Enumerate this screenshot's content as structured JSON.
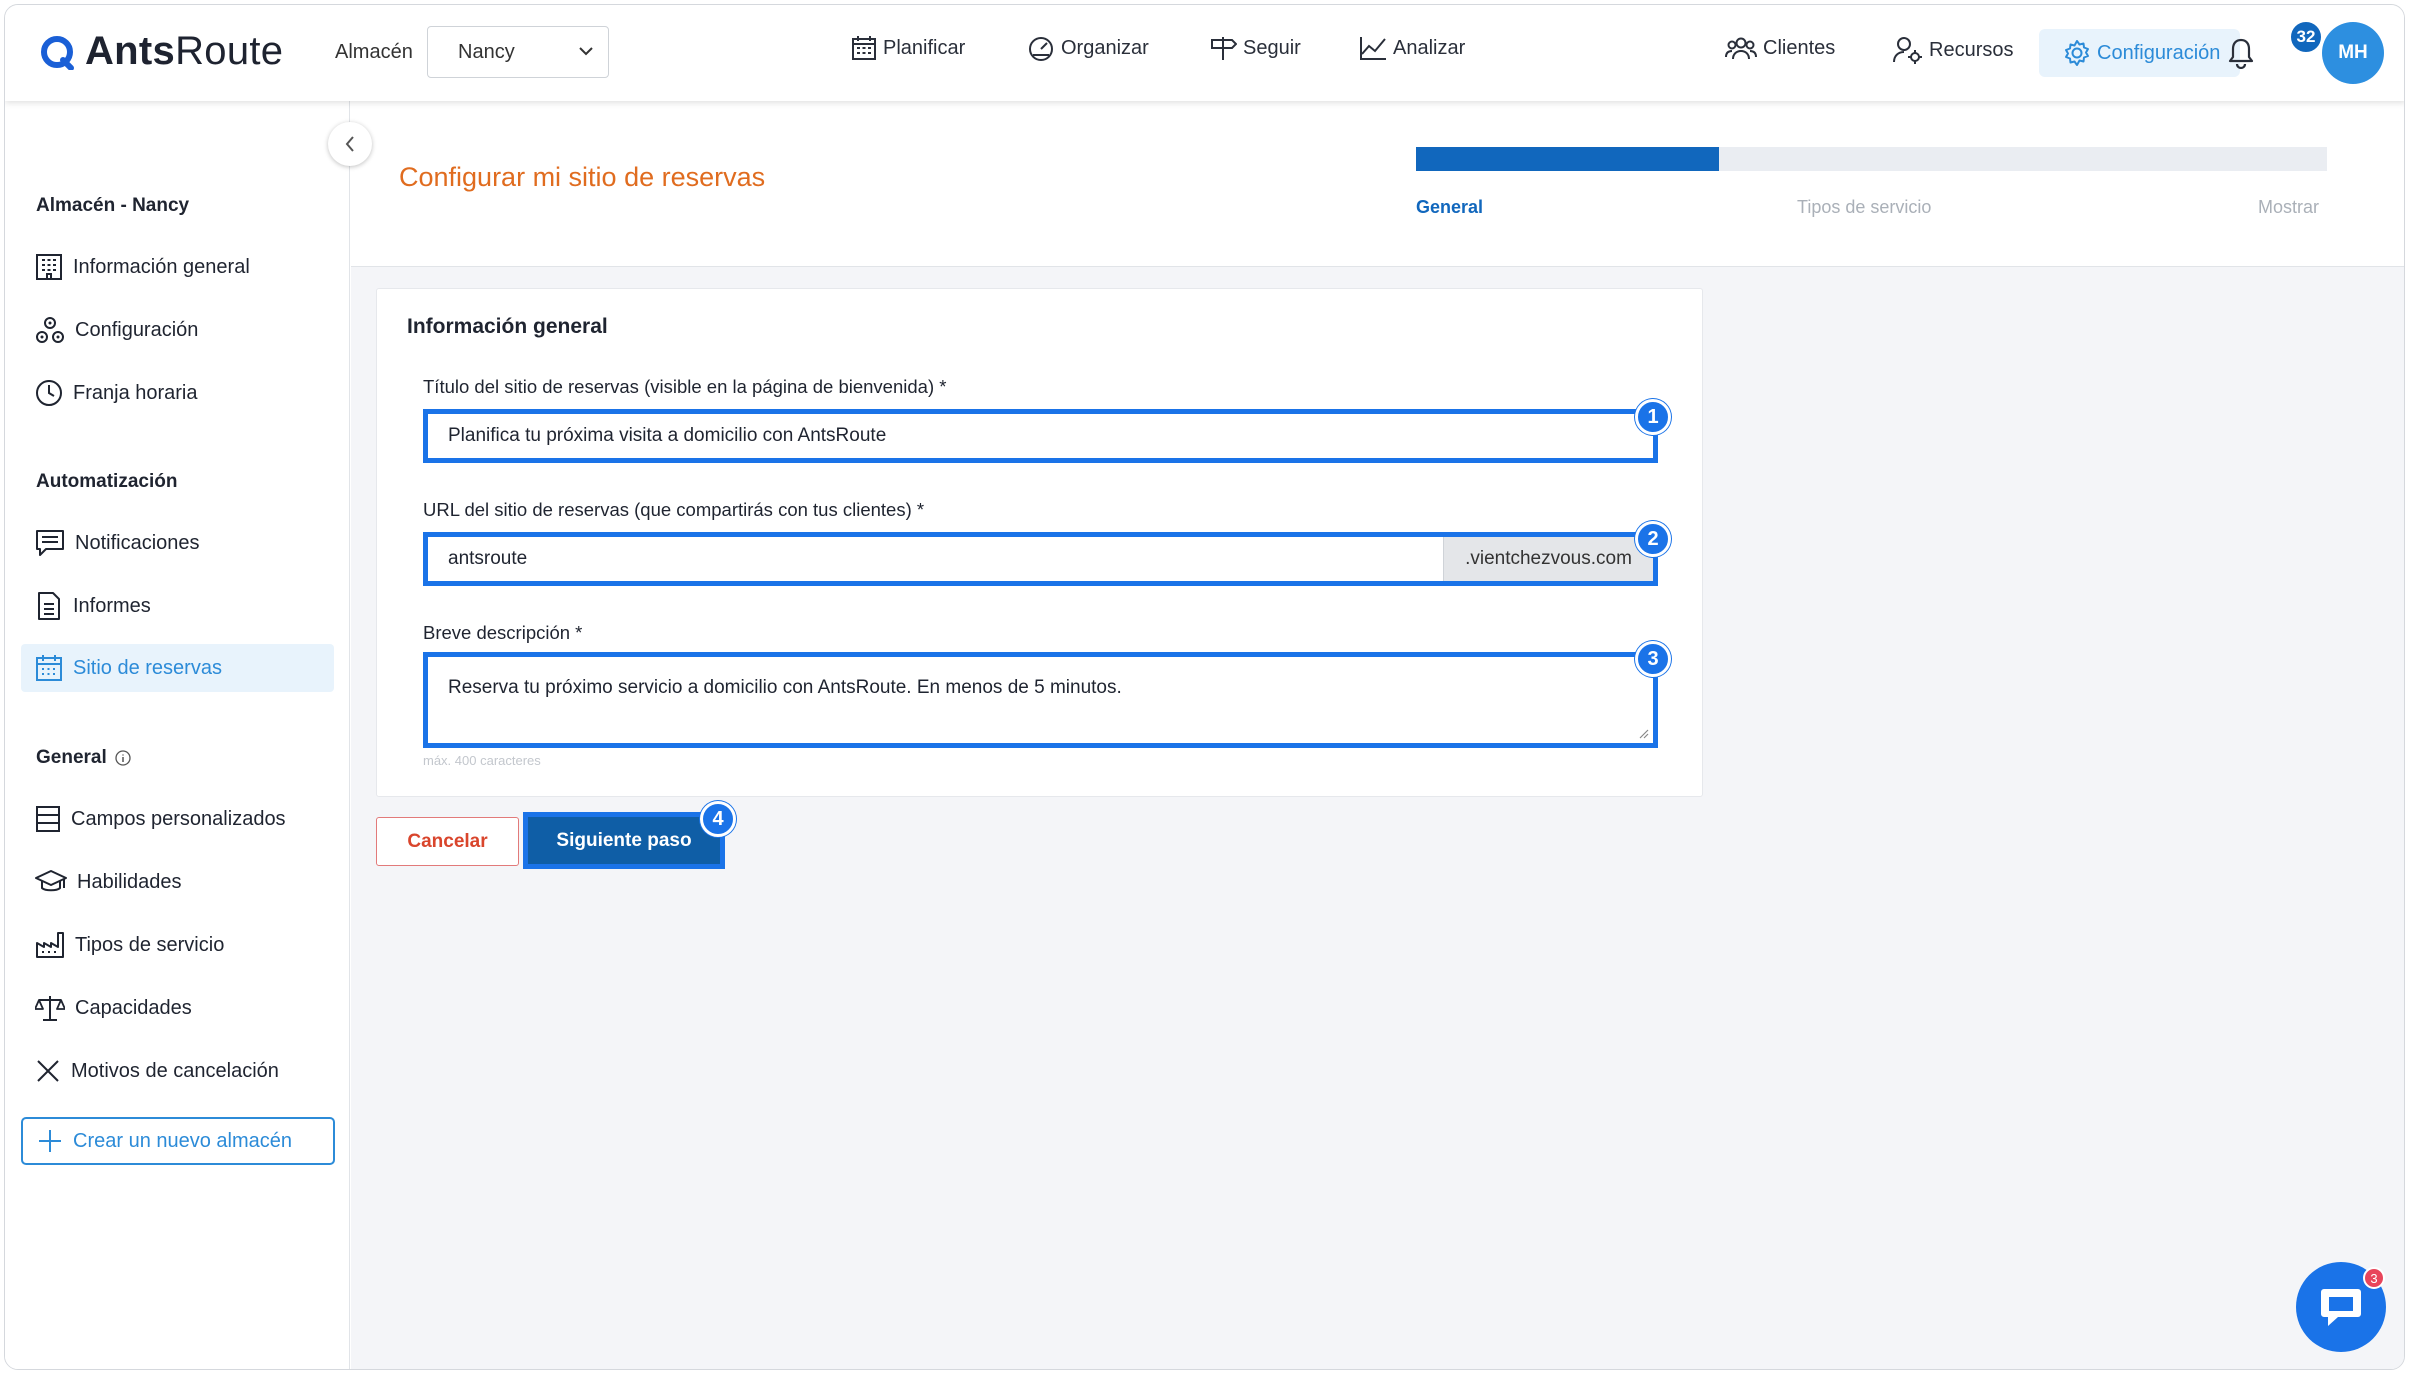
{
  "app": {
    "logo_text_bold": "Ants",
    "logo_text_light": "Route"
  },
  "header": {
    "warehouse_label": "Almacén",
    "warehouse_value": "Nancy",
    "nav": [
      {
        "label": "Planificar",
        "icon": "calendar-icon"
      },
      {
        "label": "Organizar",
        "icon": "gauge-icon"
      },
      {
        "label": "Seguir",
        "icon": "signpost-icon"
      },
      {
        "label": "Analizar",
        "icon": "chart-icon"
      }
    ],
    "right_nav": [
      {
        "label": "Clientes",
        "icon": "people-icon"
      },
      {
        "label": "Recursos",
        "icon": "user-gear-icon"
      },
      {
        "label": "Configuración",
        "icon": "gear-icon",
        "active": true
      }
    ],
    "notifications_count": "32",
    "avatar_initials": "MH"
  },
  "sidebar": {
    "section_warehouse": "Almacén - Nancy",
    "warehouse_items": [
      {
        "label": "Información general",
        "icon": "building-icon"
      },
      {
        "label": "Configuración",
        "icon": "cogs-icon"
      },
      {
        "label": "Franja horaria",
        "icon": "clock-icon"
      }
    ],
    "section_automation": "Automatización",
    "automation_items": [
      {
        "label": "Notificaciones",
        "icon": "message-icon"
      },
      {
        "label": "Informes",
        "icon": "document-icon"
      },
      {
        "label": "Sitio de reservas",
        "icon": "calendar-grid-icon",
        "active": true
      }
    ],
    "section_general": "General",
    "general_items": [
      {
        "label": "Campos personalizados",
        "icon": "rows-icon"
      },
      {
        "label": "Habilidades",
        "icon": "graduation-cap-icon"
      },
      {
        "label": "Tipos de servicio",
        "icon": "factory-icon"
      },
      {
        "label": "Capacidades",
        "icon": "scale-icon"
      },
      {
        "label": "Motivos de cancelación",
        "icon": "x-icon"
      }
    ],
    "create_label": "Crear un nuevo almacén"
  },
  "main": {
    "title": "Configurar mi sitio de reservas",
    "progress": 0.333,
    "steps": [
      "General",
      "Tipos de servicio",
      "Mostrar"
    ],
    "active_step": 0,
    "card_title": "Información general",
    "fields": {
      "title_label": "Título del sitio de reservas (visible en la página de bienvenida) *",
      "title_value": "Planifica tu próxima visita a domicilio con AntsRoute",
      "url_label": "URL del sitio de reservas (que compartirás con tus clientes) *",
      "url_value": "antsroute",
      "url_suffix": ".vientchezvous.com",
      "desc_label": "Breve descripción *",
      "desc_value": "Reserva tu próximo servicio a domicilio con AntsRoute. En menos de 5 minutos.",
      "desc_hint": "máx. 400 caracteres"
    },
    "cancel_label": "Cancelar",
    "next_label": "Siguiente paso",
    "markers": [
      "1",
      "2",
      "3",
      "4"
    ]
  },
  "chat": {
    "badge": "3"
  },
  "colors": {
    "primary": "#1167bd",
    "accent": "#2c8bd8",
    "highlight": "#1a73e8",
    "title_orange": "#e06c1f"
  }
}
